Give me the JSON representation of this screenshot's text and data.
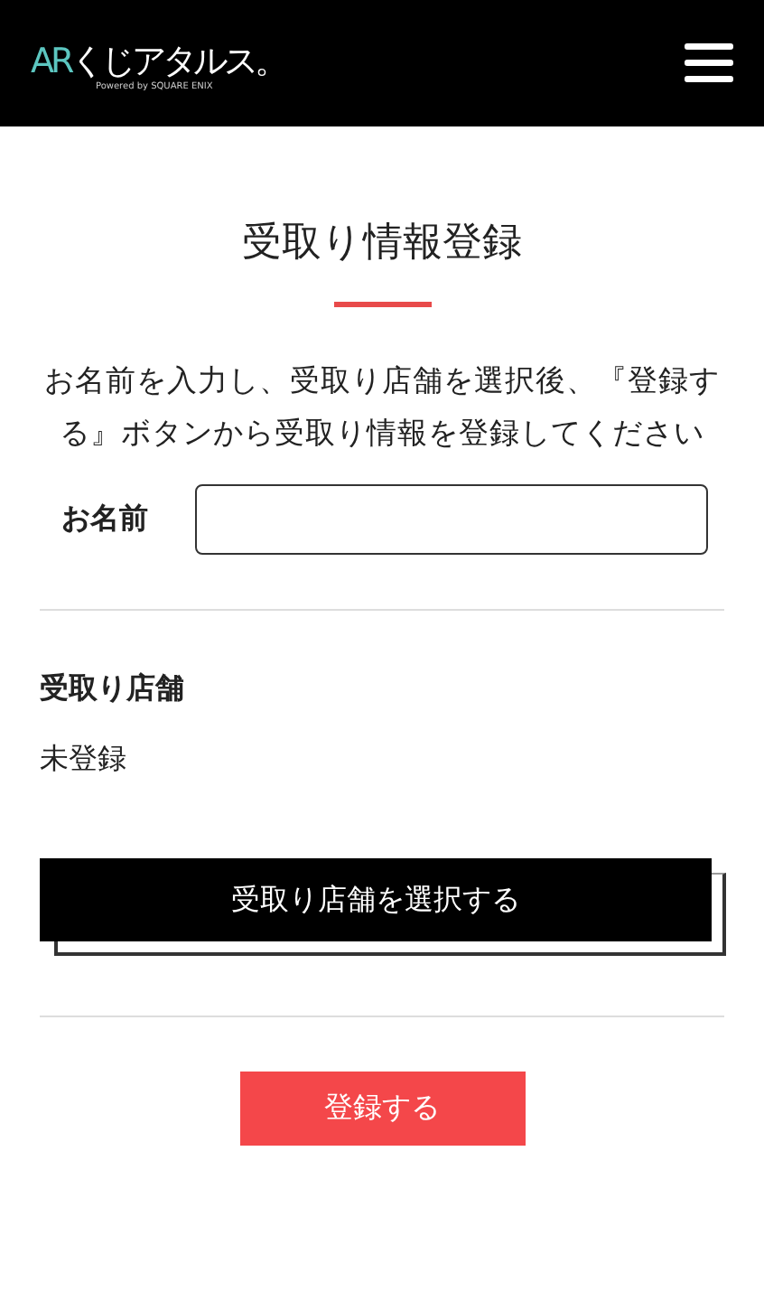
{
  "header": {
    "logo_accent": "AR",
    "logo_text": "くじアタルス。",
    "logo_sub": "Powered by SQUARE ENIX"
  },
  "title": "受取り情報登録",
  "intro": "お名前を入力し、受取り店舗を選択後、『登録する』ボタンから受取り情報を登録してください",
  "name_field": {
    "label": "お名前"
  },
  "store": {
    "label": "受取り店舗",
    "value": "未登録",
    "button": "受取り店舗を選択する"
  },
  "submit": "登録する"
}
